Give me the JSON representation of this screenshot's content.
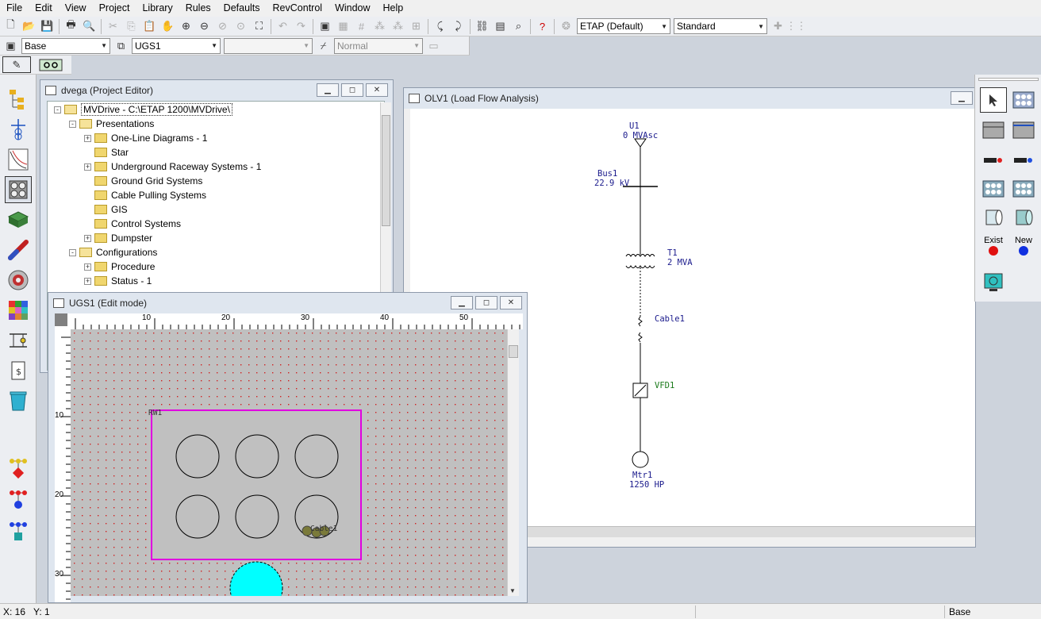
{
  "menu": [
    "File",
    "Edit",
    "View",
    "Project",
    "Library",
    "Rules",
    "Defaults",
    "RevControl",
    "Window",
    "Help"
  ],
  "toolbar": {
    "library_combo": "ETAP (Default)",
    "style_combo": "Standard",
    "presentation_combo": "Base",
    "ugs_combo": "UGS1",
    "blank_combo": "",
    "mode_combo": "Normal"
  },
  "project_editor": {
    "title": "dvega (Project Editor)",
    "tree": [
      {
        "label": "MVDrive - C:\\ETAP 1200\\MVDrive\\",
        "level": 0,
        "expander": "-",
        "open": true
      },
      {
        "label": "Presentations",
        "level": 1,
        "expander": "-",
        "open": true
      },
      {
        "label": "One-Line Diagrams - 1",
        "level": 2,
        "expander": "+",
        "open": false
      },
      {
        "label": "Star",
        "level": 2,
        "expander": "",
        "open": false
      },
      {
        "label": "Underground Raceway Systems - 1",
        "level": 2,
        "expander": "+",
        "open": false
      },
      {
        "label": "Ground Grid Systems",
        "level": 2,
        "expander": "",
        "open": false
      },
      {
        "label": "Cable Pulling Systems",
        "level": 2,
        "expander": "",
        "open": false
      },
      {
        "label": "GIS",
        "level": 2,
        "expander": "",
        "open": false
      },
      {
        "label": "Control Systems",
        "level": 2,
        "expander": "",
        "open": false
      },
      {
        "label": "Dumpster",
        "level": 2,
        "expander": "+",
        "open": false
      },
      {
        "label": "Configurations",
        "level": 1,
        "expander": "-",
        "open": true
      },
      {
        "label": "Procedure",
        "level": 2,
        "expander": "+",
        "open": false
      },
      {
        "label": "Status - 1",
        "level": 2,
        "expander": "+",
        "open": false
      }
    ]
  },
  "olv": {
    "title": "OLV1 (Load Flow Analysis)",
    "u1_name": "U1",
    "u1_value": "0 MVAsc",
    "bus_name": "Bus1",
    "bus_value": "22.9 kV",
    "t1_name": "T1",
    "t1_value": "2 MVA",
    "cable_name": "Cable1",
    "vfd_name": "VFD1",
    "motor_name": "Mtr1",
    "motor_value": "1250 HP"
  },
  "ugs": {
    "title": "UGS1 (Edit mode)",
    "h_ticks": [
      "10",
      "20",
      "30",
      "40",
      "50"
    ],
    "v_ticks": [
      "10",
      "20",
      "30"
    ],
    "raceway_label": "RW1",
    "cable_label": "Cable1",
    "colors": {
      "raceway_border": "#e000e0",
      "grid_dot": "#d02020",
      "cyan": "#00ffff"
    }
  },
  "palette": {
    "exist_label": "Exist",
    "new_label": "New"
  },
  "status": {
    "x": "X: 16",
    "y": "Y: 1",
    "presentation": "Base"
  }
}
